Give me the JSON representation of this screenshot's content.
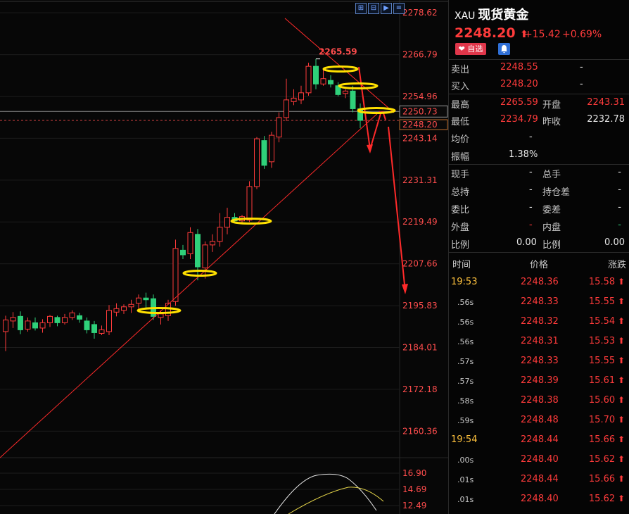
{
  "toolbar": {
    "icons": [
      "expand-icon",
      "split-icon",
      "play-icon",
      "settings-icon"
    ]
  },
  "quote": {
    "code": "XAU",
    "name": "现货黄金",
    "price": "2248.20",
    "change": "+15.42",
    "change_pct": "+0.69%",
    "fav_label": "自选",
    "sell_label": "卖出",
    "sell_value": "2248.55",
    "sell_size": "-",
    "buy_label": "买入",
    "buy_value": "2248.20",
    "buy_size": "-",
    "high_label": "最高",
    "high_value": "2265.59",
    "open_label": "开盘",
    "open_value": "2243.31",
    "low_label": "最低",
    "low_value": "2234.79",
    "prev_label": "昨收",
    "prev_value": "2232.78",
    "avg_label": "均价",
    "avg_value": "-",
    "amp_label": "振幅",
    "amp_value": "1.38%",
    "cur_vol_label": "现手",
    "cur_vol_value": "-",
    "total_vol_label": "总手",
    "total_vol_value": "-",
    "oi_label": "总持",
    "oi_value": "-",
    "oi_chg_label": "持仓差",
    "oi_chg_value": "-",
    "bid_ratio_label": "委比",
    "bid_ratio_value": "-",
    "bid_diff_label": "委差",
    "bid_diff_value": "-",
    "outer_label": "外盘",
    "outer_value": "-",
    "inner_label": "内盘",
    "inner_value": "-",
    "ratio1_label": "比例",
    "ratio1_value": "0.00",
    "ratio2_label": "比例",
    "ratio2_value": "0.00",
    "ticks_header": {
      "time": "时间",
      "price": "价格",
      "change": "涨跌"
    },
    "ticks": [
      {
        "time": "19:53",
        "price": "2248.36",
        "change": "15.58"
      },
      {
        "time": ".56s",
        "price": "2248.33",
        "change": "15.55"
      },
      {
        "time": ".56s",
        "price": "2248.32",
        "change": "15.54"
      },
      {
        "time": ".56s",
        "price": "2248.31",
        "change": "15.53"
      },
      {
        "time": ".57s",
        "price": "2248.33",
        "change": "15.55"
      },
      {
        "time": ".57s",
        "price": "2248.39",
        "change": "15.61"
      },
      {
        "time": ".58s",
        "price": "2248.38",
        "change": "15.60"
      },
      {
        "time": ".59s",
        "price": "2248.48",
        "change": "15.70"
      },
      {
        "time": "19:54",
        "price": "2248.44",
        "change": "15.66"
      },
      {
        "time": ".00s",
        "price": "2248.40",
        "change": "15.62"
      },
      {
        "time": ".01s",
        "price": "2248.44",
        "change": "15.66"
      },
      {
        "time": ".01s",
        "price": "2248.40",
        "change": "15.62"
      }
    ]
  },
  "chart_data": {
    "type": "candlestick",
    "y_ticks": [
      "2278.62",
      "2266.79",
      "2254.96",
      "2243.14",
      "2231.31",
      "2219.49",
      "2207.66",
      "2195.83",
      "2184.01",
      "2172.18",
      "2160.36"
    ],
    "ylim": [
      2152.86,
      2281.84
    ],
    "high_label": "2265.59",
    "crosshair_price": "2250.73",
    "current_price": "2248.20",
    "indicator_ticks": [
      "16.90",
      "14.69",
      "12.49"
    ],
    "colors": {
      "up": "#ff3b3b",
      "down": "#2fd07a",
      "annotation": "#ffe000",
      "trend": "#ff2a2a",
      "axis_text": "#ff4d4d"
    },
    "candles": [
      {
        "o": 2188.5,
        "h": 2193.0,
        "l": 2183.0,
        "c": 2191.8
      },
      {
        "o": 2191.5,
        "h": 2194.0,
        "l": 2189.5,
        "c": 2192.5
      },
      {
        "o": 2192.8,
        "h": 2194.2,
        "l": 2187.8,
        "c": 2189.0
      },
      {
        "o": 2189.2,
        "h": 2192.5,
        "l": 2188.5,
        "c": 2191.5
      },
      {
        "o": 2191.0,
        "h": 2192.5,
        "l": 2188.8,
        "c": 2189.5
      },
      {
        "o": 2189.5,
        "h": 2192.0,
        "l": 2188.2,
        "c": 2191.0
      },
      {
        "o": 2191.0,
        "h": 2193.2,
        "l": 2189.8,
        "c": 2192.8
      },
      {
        "o": 2192.5,
        "h": 2193.0,
        "l": 2190.0,
        "c": 2191.0
      },
      {
        "o": 2191.0,
        "h": 2193.5,
        "l": 2190.5,
        "c": 2192.5
      },
      {
        "o": 2192.5,
        "h": 2194.5,
        "l": 2191.8,
        "c": 2193.8
      },
      {
        "o": 2193.0,
        "h": 2193.8,
        "l": 2191.0,
        "c": 2192.0
      },
      {
        "o": 2191.5,
        "h": 2192.5,
        "l": 2188.0,
        "c": 2189.0
      },
      {
        "o": 2190.5,
        "h": 2191.5,
        "l": 2186.5,
        "c": 2188.2
      },
      {
        "o": 2188.0,
        "h": 2190.2,
        "l": 2187.5,
        "c": 2189.0
      },
      {
        "o": 2188.5,
        "h": 2196.0,
        "l": 2187.5,
        "c": 2194.5
      },
      {
        "o": 2194.0,
        "h": 2196.5,
        "l": 2192.8,
        "c": 2195.0
      },
      {
        "o": 2194.5,
        "h": 2196.2,
        "l": 2193.5,
        "c": 2195.5
      },
      {
        "o": 2195.5,
        "h": 2197.5,
        "l": 2193.8,
        "c": 2196.2
      },
      {
        "o": 2196.5,
        "h": 2199.0,
        "l": 2194.8,
        "c": 2198.0
      },
      {
        "o": 2198.0,
        "h": 2199.5,
        "l": 2195.0,
        "c": 2197.5
      },
      {
        "o": 2197.8,
        "h": 2199.0,
        "l": 2191.8,
        "c": 2192.8
      },
      {
        "o": 2192.5,
        "h": 2194.5,
        "l": 2190.5,
        "c": 2193.5
      },
      {
        "o": 2193.0,
        "h": 2197.5,
        "l": 2191.5,
        "c": 2196.5
      },
      {
        "o": 2197.0,
        "h": 2214.5,
        "l": 2195.8,
        "c": 2212.0
      },
      {
        "o": 2211.5,
        "h": 2213.0,
        "l": 2209.0,
        "c": 2210.2
      },
      {
        "o": 2210.5,
        "h": 2218.0,
        "l": 2209.0,
        "c": 2216.5
      },
      {
        "o": 2216.0,
        "h": 2217.5,
        "l": 2203.0,
        "c": 2206.8
      },
      {
        "o": 2206.5,
        "h": 2214.0,
        "l": 2203.5,
        "c": 2213.0
      },
      {
        "o": 2213.0,
        "h": 2216.0,
        "l": 2211.0,
        "c": 2214.0
      },
      {
        "o": 2214.0,
        "h": 2222.0,
        "l": 2212.5,
        "c": 2218.0
      },
      {
        "o": 2218.0,
        "h": 2223.5,
        "l": 2216.0,
        "c": 2220.8
      },
      {
        "o": 2220.8,
        "h": 2222.0,
        "l": 2219.5,
        "c": 2219.8
      },
      {
        "o": 2219.8,
        "h": 2221.5,
        "l": 2219.0,
        "c": 2221.0
      },
      {
        "o": 2220.0,
        "h": 2231.0,
        "l": 2219.5,
        "c": 2229.5
      },
      {
        "o": 2229.5,
        "h": 2243.5,
        "l": 2228.8,
        "c": 2243.0
      },
      {
        "o": 2242.5,
        "h": 2243.8,
        "l": 2234.5,
        "c": 2235.5
      },
      {
        "o": 2236.5,
        "h": 2245.0,
        "l": 2234.8,
        "c": 2244.0
      },
      {
        "o": 2243.5,
        "h": 2250.5,
        "l": 2242.0,
        "c": 2249.0
      },
      {
        "o": 2249.0,
        "h": 2260.0,
        "l": 2248.0,
        "c": 2254.0
      },
      {
        "o": 2253.5,
        "h": 2257.0,
        "l": 2252.5,
        "c": 2254.5
      },
      {
        "o": 2254.0,
        "h": 2258.0,
        "l": 2252.8,
        "c": 2256.0
      },
      {
        "o": 2256.0,
        "h": 2264.5,
        "l": 2255.2,
        "c": 2263.5
      },
      {
        "o": 2263.5,
        "h": 2265.59,
        "l": 2257.0,
        "c": 2258.5
      },
      {
        "o": 2258.5,
        "h": 2262.5,
        "l": 2258.0,
        "c": 2260.0
      },
      {
        "o": 2259.5,
        "h": 2261.0,
        "l": 2257.5,
        "c": 2258.5
      },
      {
        "o": 2258.0,
        "h": 2259.0,
        "l": 2255.0,
        "c": 2255.5
      },
      {
        "o": 2255.8,
        "h": 2257.0,
        "l": 2254.5,
        "c": 2256.5
      },
      {
        "o": 2256.5,
        "h": 2258.0,
        "l": 2250.5,
        "c": 2251.5
      },
      {
        "o": 2251.5,
        "h": 2253.0,
        "l": 2246.0,
        "c": 2248.2
      }
    ]
  }
}
